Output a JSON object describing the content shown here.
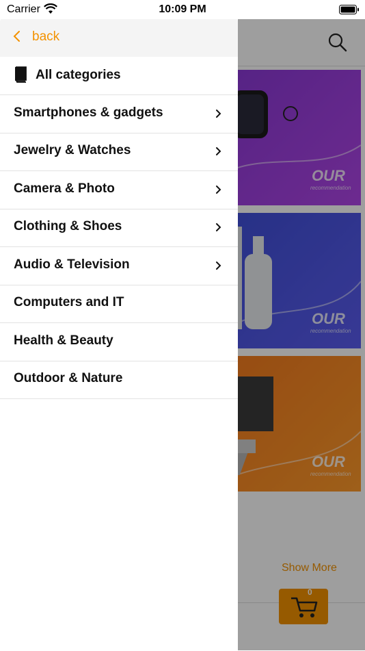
{
  "status_bar": {
    "carrier": "Carrier",
    "time": "10:09 PM"
  },
  "drawer": {
    "back_label": "back",
    "all_categories": "All categories",
    "categories": [
      {
        "label": "Smartphones & gadgets",
        "has_children": true
      },
      {
        "label": "Jewelry & Watches",
        "has_children": true
      },
      {
        "label": "Camera & Photo",
        "has_children": true
      },
      {
        "label": "Clothing & Shoes",
        "has_children": true
      },
      {
        "label": "Audio & Television",
        "has_children": true
      },
      {
        "label": "Computers and IT",
        "has_children": false
      },
      {
        "label": "Health & Beauty",
        "has_children": false
      },
      {
        "label": "Outdoor & Nature",
        "has_children": false
      }
    ]
  },
  "background": {
    "banners": [
      {
        "heading": "OUR",
        "subheading": "recommendation"
      },
      {
        "heading": "OUR",
        "subheading": "recommendation"
      },
      {
        "heading": "OUR",
        "subheading": "recommendation"
      }
    ],
    "show_more": "Show More",
    "cart_count": "0"
  },
  "colors": {
    "accent": "#f39200",
    "overlay": "rgba(0,0,0,0.38)"
  }
}
